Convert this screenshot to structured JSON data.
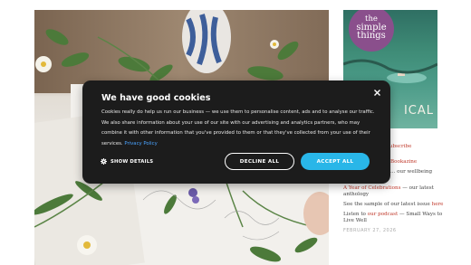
{
  "cookie_banner": {
    "title": "We have good cookies",
    "body": "Cookies really do help us run our business — we use them to personalise content, ads and to analyse our traffic. We also share information about your use of our site with our advertising and analytics partners, who may combine it with other information that you've provided to them or that they've collected from your use of their services.",
    "policy_link": "Privacy Policy",
    "show_details_label": "SHOW DETAILS",
    "decline_label": "DECLINE ALL",
    "accept_label": "ACCEPT ALL",
    "close_icon": "close-icon",
    "details_icon": "gear-icon",
    "accept_color": "#29b6e8",
    "background_color": "#1c1c1c"
  },
  "sidebar": {
    "magazine": {
      "title_line1": "the",
      "title_line2": "simple",
      "title_line3": "things",
      "cover_word": "ICAL"
    },
    "links": [
      {
        "text": "subscribe",
        "type": "link"
      },
      {
        "text": "Bookazine",
        "type": "link"
      },
      {
        "text": "... our wellbeing",
        "type": "text"
      },
      {
        "text": "bookazine",
        "type": "text"
      }
    ],
    "celebrations_link": "A Year of Celebrations",
    "celebrations_tail": " — our latest anthology",
    "sample_text": "See the sample of our latest issue",
    "sample_link": "here",
    "podcast_pre": "Listen to ",
    "podcast_link": "our podcast",
    "podcast_tail": " — Small Ways to Live Well",
    "date": "FEBRUARY 27, 2026"
  }
}
